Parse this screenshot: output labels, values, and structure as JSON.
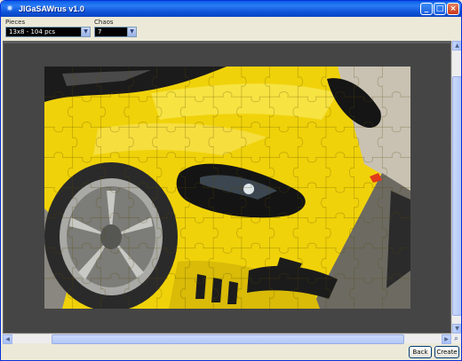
{
  "window": {
    "title": "JIGaSAWrus v1.0",
    "icons": {
      "app": "jigsaw-star-icon",
      "minimize": "minimize-icon",
      "maximize": "maximize-icon",
      "close": "close-icon"
    }
  },
  "controls": {
    "pieces_label": "Pieces",
    "pieces_value": "13x8 - 104 pcs",
    "chaos_label": "Chaos",
    "chaos_value": "7"
  },
  "puzzle": {
    "description_image": "yellow-sports-car-jigsaw",
    "columns": 13,
    "rows": 8
  },
  "buttons": {
    "back": "Back",
    "create": "Create"
  },
  "colors": {
    "title_bar": "#0a5ee6",
    "canvas": "#454545",
    "car_yellow": "#f2d50b"
  }
}
